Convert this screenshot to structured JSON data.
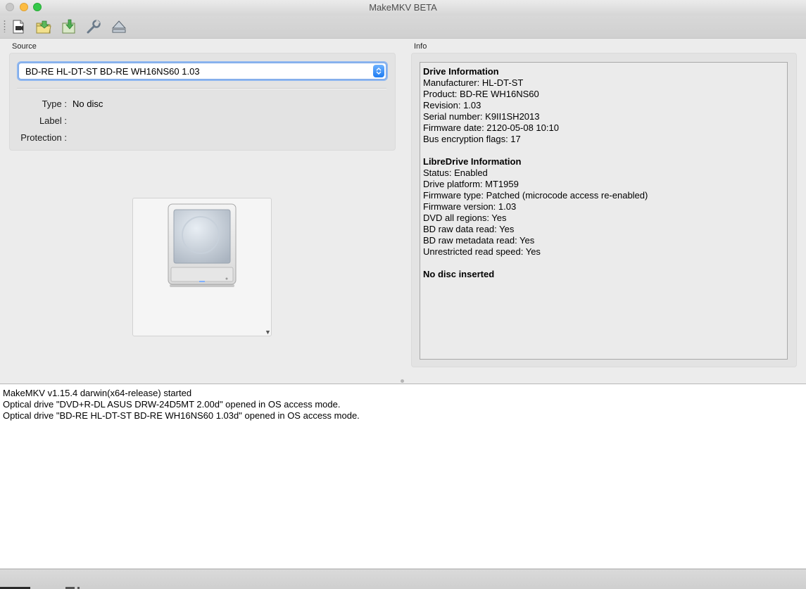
{
  "window": {
    "title": "MakeMKV BETA"
  },
  "toolbar": {
    "buttons": [
      {
        "icon": "open-file-icon"
      },
      {
        "icon": "open-folder-icon"
      },
      {
        "icon": "backup-icon"
      },
      {
        "icon": "preferences-wrench-icon"
      },
      {
        "icon": "eject-icon"
      }
    ]
  },
  "source": {
    "label": "Source",
    "drive_selected": "BD-RE HL-DT-ST BD-RE  WH16NS60 1.03",
    "type_label": "Type :",
    "type_value": "No disc",
    "label_label": "Label :",
    "label_value": "",
    "protection_label": "Protection :",
    "protection_value": ""
  },
  "info": {
    "label": "Info",
    "drive_heading": "Drive Information",
    "drive_lines": [
      "Manufacturer: HL-DT-ST",
      "Product: BD-RE WH16NS60",
      "Revision: 1.03",
      "Serial number: K9II1SH2013",
      "Firmware date: 2120-05-08 10:10",
      "Bus encryption flags: 17"
    ],
    "libre_heading": "LibreDrive Information",
    "libre_lines": [
      "Status: Enabled",
      "Drive platform: MT1959",
      "Firmware type: Patched (microcode access re-enabled)",
      "Firmware version: 1.03",
      "DVD all regions: Yes",
      "BD raw data read: Yes",
      "BD raw metadata read: Yes",
      "Unrestricted read speed: Yes"
    ],
    "disc_status": "No disc inserted"
  },
  "log": {
    "lines": [
      "MakeMKV v1.15.4 darwin(x64-release) started",
      "Optical drive \"DVD+R-DL ASUS DRW-24D5MT 2.00d\" opened in OS access mode.",
      "Optical drive \"BD-RE HL-DT-ST BD-RE WH16NS60 1.03d\" opened in OS access mode."
    ]
  }
}
